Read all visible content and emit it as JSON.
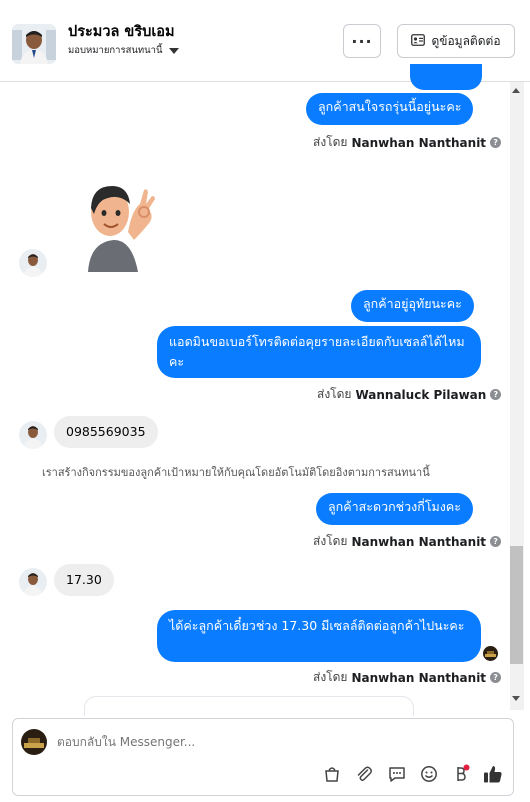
{
  "header": {
    "name": "ประมวล ขริบเอม",
    "assign_label": "มอบหมายการสนทนานี้",
    "more_label": "···",
    "contact_label": "ดูข้อมูลติดต่อ"
  },
  "messages": [
    {
      "text": "ลูกค้าสนใจรถรุ่นนี้อยู่นะคะ",
      "sent_by_prefix": "ส่งโดย",
      "sent_by_name": "Nanwhan Nanthanit"
    },
    {
      "text": "ลูกค้าอยู่อุทัยนะคะ"
    },
    {
      "text": "แอดมินขอเบอร์โทรติดต่อคุยรายละเอียดกับเซลล์ได้ไหมคะ",
      "sent_by_prefix": "ส่งโดย",
      "sent_by_name": "Wannaluck Pilawan"
    },
    {
      "text": "0985569035"
    },
    {
      "text": "เราสร้างกิจกรรมของลูกค้าเป้าหมายให้กับคุณโดยอัตโนมัติโดยอิงตามการสนทนานี้"
    },
    {
      "text": "ลูกค้าสะดวกช่วงกี่โมงคะ",
      "sent_by_prefix": "ส่งโดย",
      "sent_by_name": "Nanwhan Nanthanit"
    },
    {
      "text": "17.30"
    },
    {
      "text": "ได้ค่ะลูกค้าเดี๋ยวช่วง 17.30 มีเซลล์ติดต่อลูกค้าไปนะคะ",
      "sent_by_prefix": "ส่งโดย",
      "sent_by_name": "Nanwhan Nanthanit"
    }
  ],
  "composer": {
    "placeholder": "ตอบกลับใน Messenger..."
  },
  "colors": {
    "accent": "#0a7cff",
    "incoming_bubble": "#eeeeee",
    "notification_dot": "#e41e3f"
  }
}
